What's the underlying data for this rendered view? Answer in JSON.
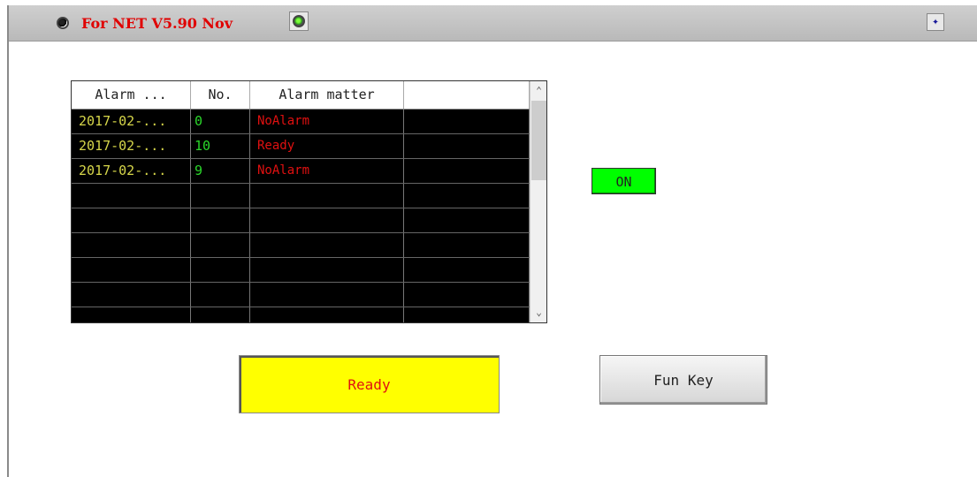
{
  "titlebar": {
    "title": "For NET V5.90  Nov",
    "left_indicator_icon": "record-indicator-icon",
    "right_indicator_icon": "green-led-icon",
    "corner_icon": "cursor-pointer-icon"
  },
  "alarm_table": {
    "columns": [
      "Alarm ...",
      "No.",
      "Alarm matter",
      ""
    ],
    "rows": [
      {
        "time": "2017-02-...",
        "no": "0",
        "matter": "NoAlarm"
      },
      {
        "time": "2017-02-...",
        "no": "10",
        "matter": "Ready"
      },
      {
        "time": "2017-02-...",
        "no": "9",
        "matter": "NoAlarm"
      }
    ],
    "empty_rows": 6
  },
  "status_toggle": {
    "label": "ON",
    "color": "#00ff00"
  },
  "status_display": {
    "text": "Ready",
    "color": "#ffff00"
  },
  "fun_key": {
    "label": "Fun Key"
  },
  "colors": {
    "title_red": "#e00000",
    "time_yellow": "#d6d64a",
    "no_green": "#2ad62a",
    "matter_red": "#e01010",
    "table_bg": "#000000"
  }
}
